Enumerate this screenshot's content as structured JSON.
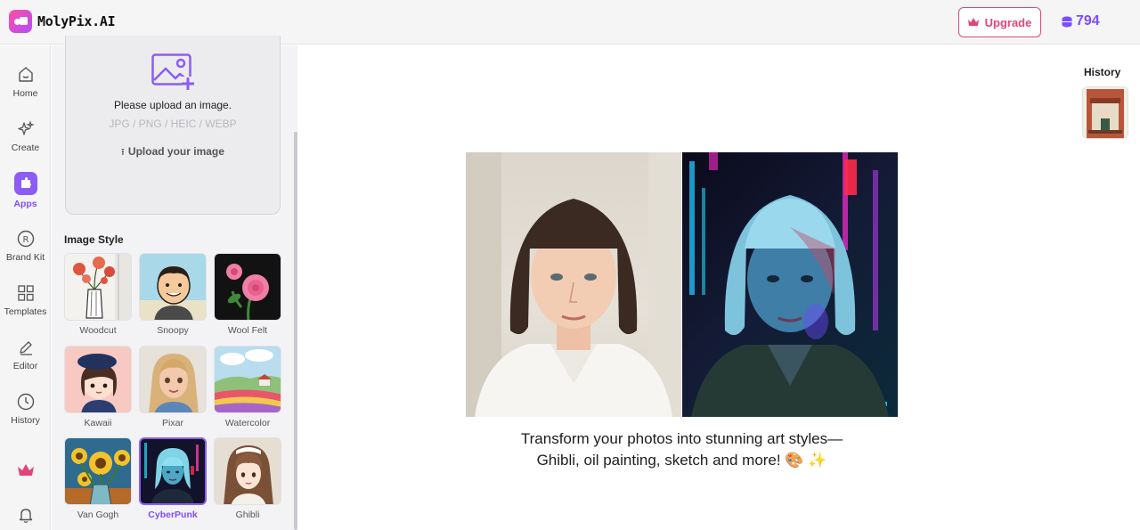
{
  "app": {
    "name": "MolyPix.AI"
  },
  "header": {
    "upgrade_label": "Upgrade",
    "credits": "794",
    "accent": "#7c4dff",
    "upgrade_color": "#e0457a"
  },
  "rail": {
    "items": [
      {
        "label": "Home",
        "icon": "home-icon"
      },
      {
        "label": "Create",
        "icon": "sparkles-icon"
      },
      {
        "label": "Apps",
        "icon": "apps-icon",
        "active": true
      },
      {
        "label": "Brand Kit",
        "icon": "registered-icon"
      },
      {
        "label": "Templates",
        "icon": "grid-icon"
      },
      {
        "label": "Editor",
        "icon": "pencil-icon"
      },
      {
        "label": "History",
        "icon": "clock-icon"
      }
    ],
    "bottom": [
      {
        "icon": "crown-icon"
      },
      {
        "icon": "bell-icon"
      }
    ]
  },
  "upload": {
    "title": "Please upload an image.",
    "types": "JPG / PNG / HEIC / WEBP",
    "button": "Upload your image"
  },
  "styles": {
    "title": "Image Style",
    "items": [
      {
        "name": "Woodcut"
      },
      {
        "name": "Snoopy"
      },
      {
        "name": "Wool Felt"
      },
      {
        "name": "Kawaii"
      },
      {
        "name": "Pixar"
      },
      {
        "name": "Watercolor"
      },
      {
        "name": "Van Gogh"
      },
      {
        "name": "CyberPunk",
        "selected": true
      },
      {
        "name": "Ghibli"
      }
    ]
  },
  "main": {
    "caption": "Transform your photos into stunning art styles—Ghibli, oil painting, sketch and more! 🎨 ✨"
  },
  "history": {
    "title": "History"
  }
}
